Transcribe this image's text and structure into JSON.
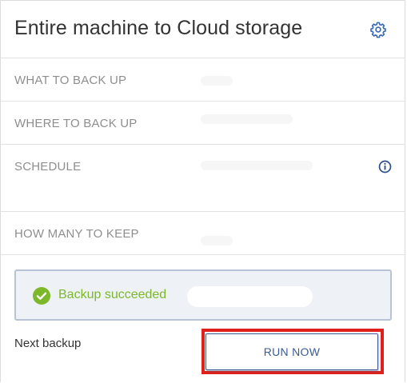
{
  "plan": {
    "title": "Entire machine to Cloud storage",
    "settings_icon": "gear-icon"
  },
  "sections": {
    "what": {
      "label": "WHAT TO BACK UP"
    },
    "where": {
      "label": "WHERE TO BACK UP"
    },
    "schedule": {
      "label": "SCHEDULE",
      "icon": "info-icon"
    },
    "retention": {
      "label": "HOW MANY TO KEEP"
    }
  },
  "status": {
    "text": "Backup succeeded",
    "icon": "check-circle-icon",
    "color": "#7cb829"
  },
  "footer": {
    "next_backup_label": "Next backup",
    "run_now_label": "RUN NOW"
  },
  "colors": {
    "accent": "#3b5a94",
    "success": "#7cb829",
    "highlight": "#e0201a"
  }
}
